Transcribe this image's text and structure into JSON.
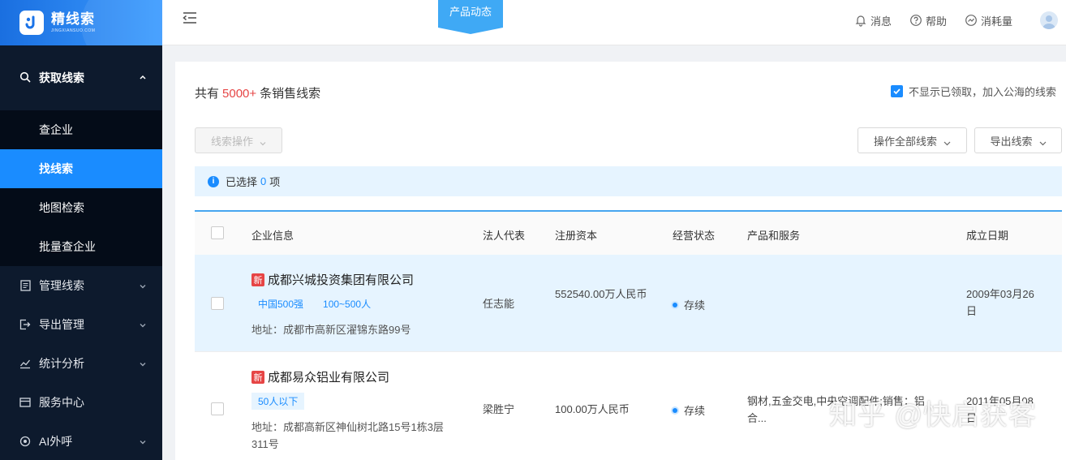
{
  "brand": {
    "name": "精线索",
    "sub": "JINGXIANSUO.COM"
  },
  "sidebar": {
    "top": {
      "label": "获取线索"
    },
    "sub_items": [
      {
        "label": "查企业"
      },
      {
        "label": "找线索",
        "active": true
      },
      {
        "label": "地图检索"
      },
      {
        "label": "批量查企业"
      }
    ],
    "items": [
      {
        "label": "管理线索",
        "icon": "list-icon"
      },
      {
        "label": "导出管理",
        "icon": "export-icon"
      },
      {
        "label": "统计分析",
        "icon": "chart-icon"
      },
      {
        "label": "服务中心",
        "icon": "service-icon"
      },
      {
        "label": "AI外呼",
        "icon": "ai-icon"
      }
    ]
  },
  "header": {
    "product_tag": "产品动态",
    "actions": [
      {
        "label": "消息",
        "icon": "bell-icon"
      },
      {
        "label": "帮助",
        "icon": "help-icon"
      },
      {
        "label": "消耗量",
        "icon": "usage-icon"
      }
    ]
  },
  "summary": {
    "prefix": "共有",
    "count": "5000+",
    "suffix": "条销售线索"
  },
  "hide_option": {
    "label": "不显示已领取，加入公海的线索",
    "checked": true
  },
  "toolbar": {
    "lead_ops": "线索操作",
    "op_all": "操作全部线索",
    "export": "导出线索"
  },
  "selected": {
    "prefix": "已选择",
    "count": "0",
    "suffix": "项"
  },
  "table": {
    "columns": [
      "企业信息",
      "法人代表",
      "注册资本",
      "经营状态",
      "产品和服务",
      "成立日期"
    ],
    "rows": [
      {
        "new_tag": "新",
        "name": "成都兴城投资集团有限公司",
        "tags": [
          "中国500强",
          "100~500人"
        ],
        "address": "地址：成都市高新区濯锦东路99号",
        "legal": "任志能",
        "capital": "552540.00万人民币",
        "status": "存续",
        "products": "",
        "date": "2009年03月26日"
      },
      {
        "new_tag": "新",
        "name": "成都易众铝业有限公司",
        "tags": [
          "50人以下"
        ],
        "address": "地址：成都高新区神仙树北路15号1栋3层311号",
        "legal": "梁胜宁",
        "capital": "100.00万人民币",
        "status": "存续",
        "products": "钢材,五金交电,中央空调配件;销售：铝合...",
        "date": "2011年05月08日"
      }
    ]
  },
  "watermark": "知乎 @快启获客"
}
